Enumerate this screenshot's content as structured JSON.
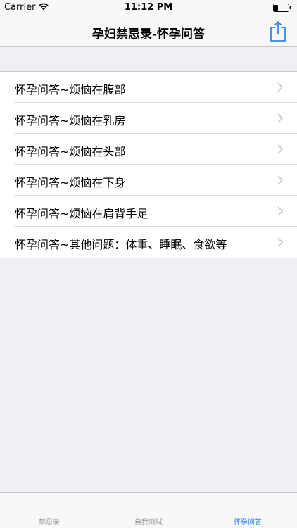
{
  "status_bar": {
    "carrier": "Carrier",
    "time": "11:12 PM"
  },
  "nav": {
    "title": "孕妇禁忌录-怀孕问答",
    "share_icon": "share-icon"
  },
  "list": {
    "items": [
      {
        "label": "怀孕问答~烦恼在腹部"
      },
      {
        "label": "怀孕问答~烦恼在乳房"
      },
      {
        "label": "怀孕问答~烦恼在头部"
      },
      {
        "label": "怀孕问答~烦恼在下身"
      },
      {
        "label": "怀孕问答~烦恼在肩背手足"
      },
      {
        "label": "怀孕问答~其他问题：体重、睡眠、食欲等"
      }
    ]
  },
  "tabs": [
    {
      "label": "禁忌录",
      "active": false
    },
    {
      "label": "自我测试",
      "active": false
    },
    {
      "label": "怀孕问答",
      "active": true
    }
  ],
  "colors": {
    "accent": "#1a7cf5",
    "inactive_tab": "#929292",
    "background": "#efeff4"
  }
}
